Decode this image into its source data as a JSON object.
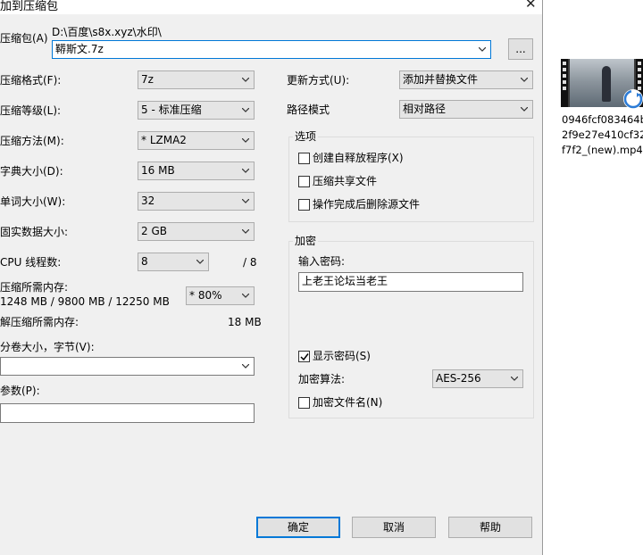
{
  "window": {
    "title": "加到压缩包",
    "close_glyph": "✕"
  },
  "archive": {
    "label": "压缩包(A)",
    "path": "D:\\百度\\s8x.xyz\\水印\\",
    "filename": "鞯斯文.7z",
    "browse_label": "..."
  },
  "left": {
    "format": {
      "label": "压缩格式(F):",
      "value": "7z"
    },
    "level": {
      "label": "压缩等级(L):",
      "value": "5 - 标准压缩"
    },
    "method": {
      "label": "压缩方法(M):",
      "value": "*  LZMA2"
    },
    "dict": {
      "label": "字典大小(D):",
      "value": "16 MB"
    },
    "word": {
      "label": "单词大小(W):",
      "value": "32"
    },
    "solid": {
      "label": "固实数据大小:",
      "value": "2 GB"
    },
    "threads": {
      "label": "CPU 线程数:",
      "value": "8",
      "total": "/ 8"
    },
    "mem_compress": {
      "label": "压缩所需内存:",
      "detail": "1248 MB / 9800 MB / 12250 MB",
      "percent": "* 80%"
    },
    "mem_decompress": {
      "label": "解压缩所需内存:",
      "value": "18 MB"
    },
    "volume": {
      "label": "分卷大小，字节(V):",
      "value": ""
    },
    "params": {
      "label": "参数(P):",
      "value": ""
    }
  },
  "right": {
    "update": {
      "label": "更新方式(U):",
      "value": "添加并替换文件"
    },
    "path_mode": {
      "label": "路径模式",
      "value": "相对路径"
    },
    "options": {
      "title": "选项",
      "sfx": {
        "label": "创建自释放程序(X)",
        "checked": false
      },
      "shared": {
        "label": "压缩共享文件",
        "checked": false
      },
      "delete": {
        "label": "操作完成后删除源文件",
        "checked": false
      }
    },
    "encryption": {
      "title": "加密",
      "password_label": "输入密码:",
      "password_value": "上老王论坛当老王",
      "show_password": {
        "label": "显示密码(S)",
        "checked": true
      },
      "method_label": "加密算法:",
      "method_value": "AES-256",
      "encrypt_names": {
        "label": "加密文件名(N)",
        "checked": false
      }
    }
  },
  "buttons": {
    "ok": "确定",
    "cancel": "取消",
    "help": "帮助"
  },
  "desktop": {
    "file_label_lines": [
      "0946fcf083464b",
      "2f9e27e410cf32",
      "f7f2_(new).mp4"
    ]
  },
  "colors": {
    "dialog_bg": "#f0f0f0",
    "focus_border": "#0078d7",
    "desktop_bg": "#ffffff"
  }
}
